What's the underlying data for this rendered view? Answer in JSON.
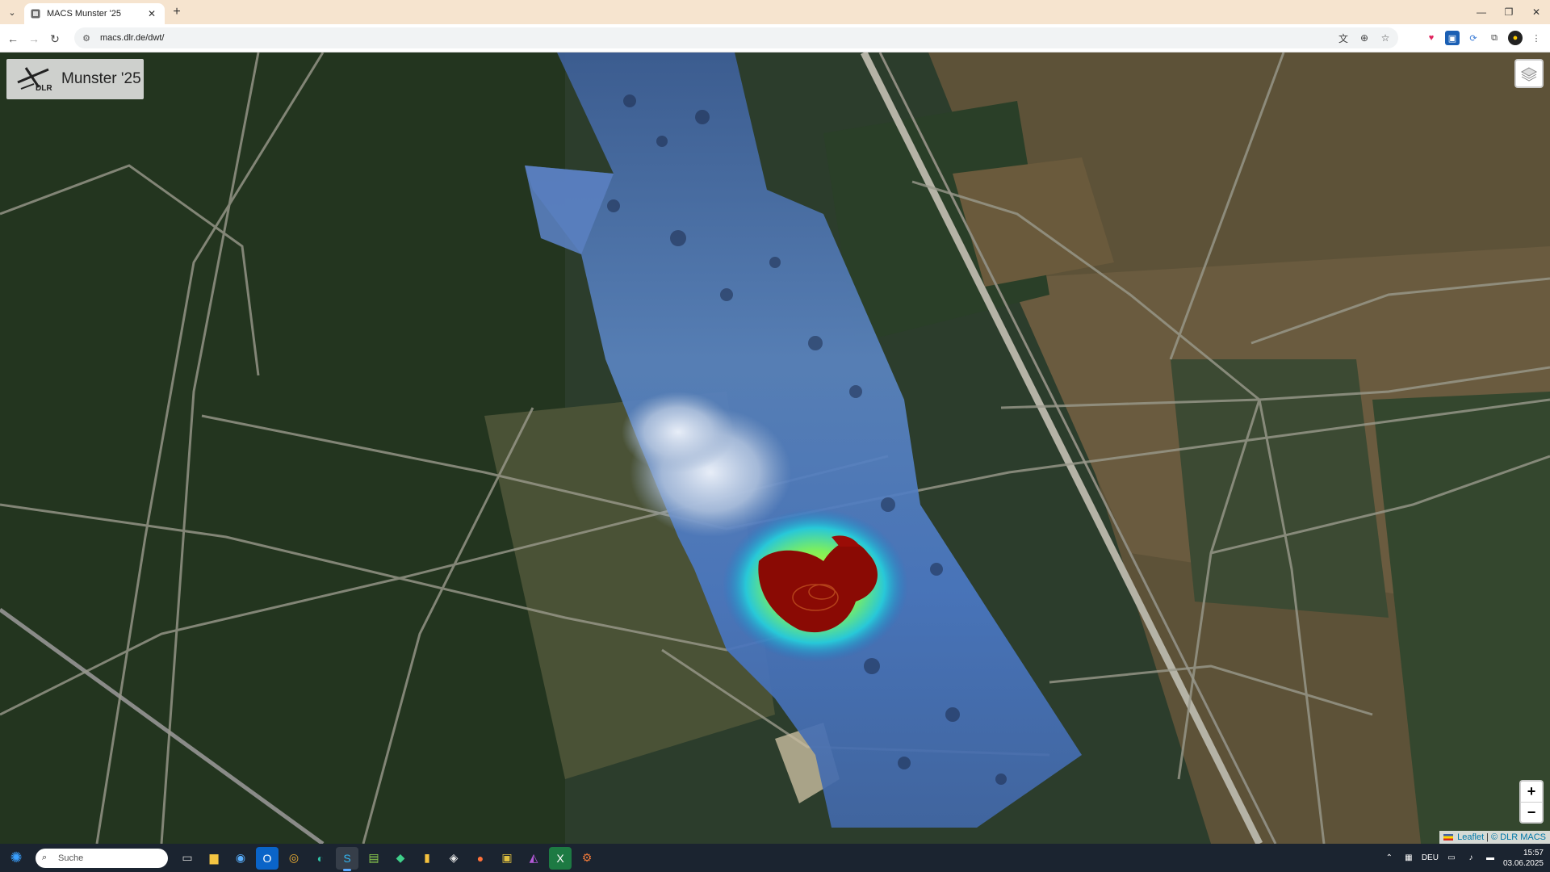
{
  "browser": {
    "tab": {
      "title": "MACS Munster '25"
    },
    "url": "macs.dlr.de/dwt/"
  },
  "map": {
    "brand": {
      "logo_text": "DLR",
      "title": "Munster '25"
    },
    "zoom": {
      "in_label": "+",
      "out_label": "−"
    },
    "attribution": {
      "leaflet": "Leaflet",
      "separator": "|",
      "credit": "© DLR MACS"
    }
  },
  "taskbar": {
    "search_placeholder": "Suche",
    "apps": [
      "task-view",
      "file-explorer",
      "globe",
      "outlook",
      "chrome",
      "edge",
      "skype",
      "notepad-plus",
      "app-green",
      "file-yellow",
      "app-dark",
      "firefox",
      "app-img",
      "app-purple",
      "excel",
      "app-gear"
    ],
    "tray": {
      "language": "DEU",
      "time": "15:57",
      "date": "03.06.2025"
    }
  }
}
